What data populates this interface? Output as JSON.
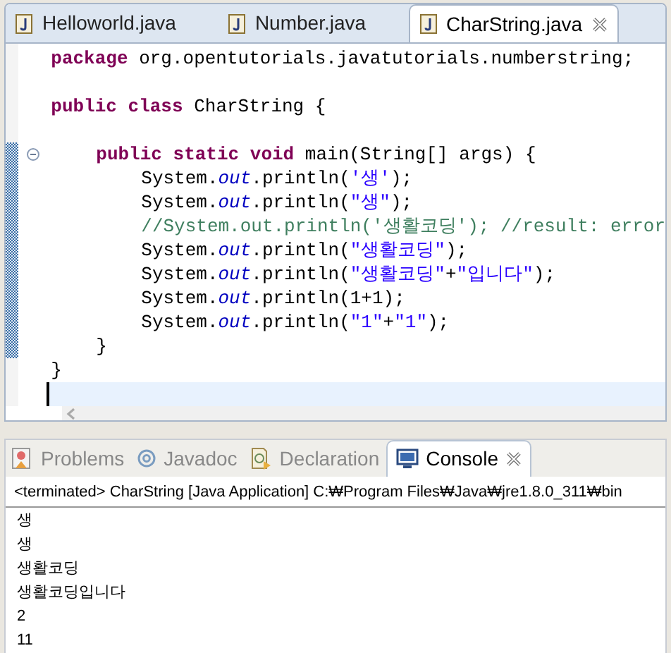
{
  "editor_tabs": [
    {
      "label": "Helloworld.java",
      "selected": false
    },
    {
      "label": "Number.java",
      "selected": false
    },
    {
      "label": "CharString.java",
      "selected": true
    }
  ],
  "code_lines": [
    {
      "tokens": [
        {
          "kind": "keyword",
          "text": "package"
        },
        {
          "kind": "plain",
          "text": "org.opentutorials.javatutorials.numberstring;"
        }
      ]
    },
    {
      "gap_before": true,
      "tokens": [
        {
          "kind": "keyword",
          "text": "public"
        },
        {
          "kind": "keyword",
          "text": "class"
        },
        {
          "kind": "plain",
          "text": "CharString {"
        }
      ],
      "children": [
        {
          "gap_before": true,
          "folded": false,
          "tokens": [
            {
              "kind": "keyword",
              "text": "public"
            },
            {
              "kind": "keyword",
              "text": "static"
            },
            {
              "kind": "keyword",
              "text": "void"
            },
            {
              "kind": "plain",
              "text": "main(String[] args) {"
            }
          ],
          "children": [
            {
              "tokens": [
                {
                  "kind": "plain",
                  "text": "System."
                },
                {
                  "kind": "field",
                  "text": "out"
                },
                {
                  "kind": "plain",
                  "text": ".println("
                },
                {
                  "kind": "string",
                  "text": "'생'"
                },
                {
                  "kind": "plain",
                  "text": ");"
                }
              ]
            },
            {
              "tokens": [
                {
                  "kind": "plain",
                  "text": "System."
                },
                {
                  "kind": "field",
                  "text": "out"
                },
                {
                  "kind": "plain",
                  "text": ".println("
                },
                {
                  "kind": "string",
                  "text": "\"생\""
                },
                {
                  "kind": "plain",
                  "text": ");"
                }
              ]
            },
            {
              "tokens": [
                {
                  "kind": "comment",
                  "text": "//System.out.println('생활코딩'); //result: error"
                }
              ]
            },
            {
              "tokens": [
                {
                  "kind": "plain",
                  "text": "System."
                },
                {
                  "kind": "field",
                  "text": "out"
                },
                {
                  "kind": "plain",
                  "text": ".println("
                },
                {
                  "kind": "string",
                  "text": "\"생활코딩\""
                },
                {
                  "kind": "plain",
                  "text": ");"
                }
              ]
            },
            {
              "tokens": [
                {
                  "kind": "plain",
                  "text": "System."
                },
                {
                  "kind": "field",
                  "text": "out"
                },
                {
                  "kind": "plain",
                  "text": ".println("
                },
                {
                  "kind": "string",
                  "text": "\"생활코딩\""
                },
                {
                  "kind": "plain",
                  "text": "+"
                },
                {
                  "kind": "string",
                  "text": "\"입니다\""
                },
                {
                  "kind": "plain",
                  "text": ");"
                }
              ]
            },
            {
              "tokens": [
                {
                  "kind": "plain",
                  "text": "System."
                },
                {
                  "kind": "field",
                  "text": "out"
                },
                {
                  "kind": "plain",
                  "text": ".println(1+1);"
                }
              ]
            },
            {
              "tokens": [
                {
                  "kind": "plain",
                  "text": "System."
                },
                {
                  "kind": "field",
                  "text": "out"
                },
                {
                  "kind": "plain",
                  "text": ".println("
                },
                {
                  "kind": "string",
                  "text": "\"1\""
                },
                {
                  "kind": "plain",
                  "text": "+"
                },
                {
                  "kind": "string",
                  "text": "\"1\""
                },
                {
                  "kind": "plain",
                  "text": ");"
                }
              ]
            }
          ]
        },
        {
          "tokens": [
            {
              "kind": "plain",
              "text": "}"
            }
          ]
        }
      ]
    },
    {
      "tokens": [
        {
          "kind": "plain",
          "text": "}"
        }
      ],
      "cursor_below": true
    }
  ],
  "view_tabs": [
    {
      "label": "Problems",
      "selected": false
    },
    {
      "label": "Javadoc",
      "selected": false
    },
    {
      "label": "Declaration",
      "selected": false
    },
    {
      "label": "Console",
      "selected": true
    }
  ],
  "console": {
    "header": "<terminated> CharString [Java Application] C:₩Program Files₩Java₩jre1.8.0_311₩bin",
    "lines": [
      "생",
      "생",
      "생활코딩",
      "생활코딩입니다",
      "2",
      "11"
    ]
  }
}
